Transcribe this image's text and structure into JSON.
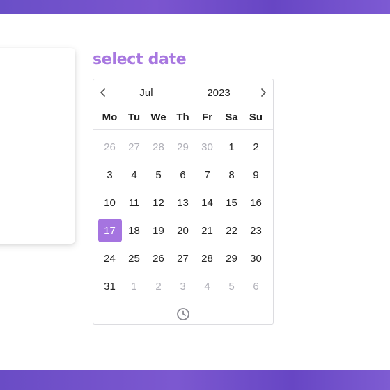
{
  "field": {
    "label": "select date"
  },
  "calendar": {
    "month": "Jul",
    "year": "2023",
    "weekdays": [
      "Mo",
      "Tu",
      "We",
      "Th",
      "Fr",
      "Sa",
      "Su"
    ],
    "weeks": [
      [
        {
          "d": "26",
          "muted": true
        },
        {
          "d": "27",
          "muted": true
        },
        {
          "d": "28",
          "muted": true
        },
        {
          "d": "29",
          "muted": true
        },
        {
          "d": "30",
          "muted": true
        },
        {
          "d": "1"
        },
        {
          "d": "2"
        }
      ],
      [
        {
          "d": "3"
        },
        {
          "d": "4"
        },
        {
          "d": "5"
        },
        {
          "d": "6"
        },
        {
          "d": "7"
        },
        {
          "d": "8"
        },
        {
          "d": "9"
        }
      ],
      [
        {
          "d": "10"
        },
        {
          "d": "11"
        },
        {
          "d": "12"
        },
        {
          "d": "13"
        },
        {
          "d": "14"
        },
        {
          "d": "15"
        },
        {
          "d": "16"
        }
      ],
      [
        {
          "d": "17",
          "selected": true
        },
        {
          "d": "18"
        },
        {
          "d": "19"
        },
        {
          "d": "20"
        },
        {
          "d": "21"
        },
        {
          "d": "22"
        },
        {
          "d": "23"
        }
      ],
      [
        {
          "d": "24"
        },
        {
          "d": "25"
        },
        {
          "d": "26"
        },
        {
          "d": "27"
        },
        {
          "d": "28"
        },
        {
          "d": "29"
        },
        {
          "d": "30"
        }
      ],
      [
        {
          "d": "31"
        },
        {
          "d": "1",
          "muted": true
        },
        {
          "d": "2",
          "muted": true
        },
        {
          "d": "3",
          "muted": true
        },
        {
          "d": "4",
          "muted": true
        },
        {
          "d": "5",
          "muted": true
        },
        {
          "d": "6",
          "muted": true
        }
      ]
    ],
    "icons": {
      "prev": "chevron-left-icon",
      "next": "chevron-right-icon",
      "time": "clock-icon"
    }
  },
  "colors": {
    "accent": "#a574e0",
    "label": "#a878e0",
    "band": "#6a4fc7",
    "muted_text": "#b0b0b8"
  }
}
